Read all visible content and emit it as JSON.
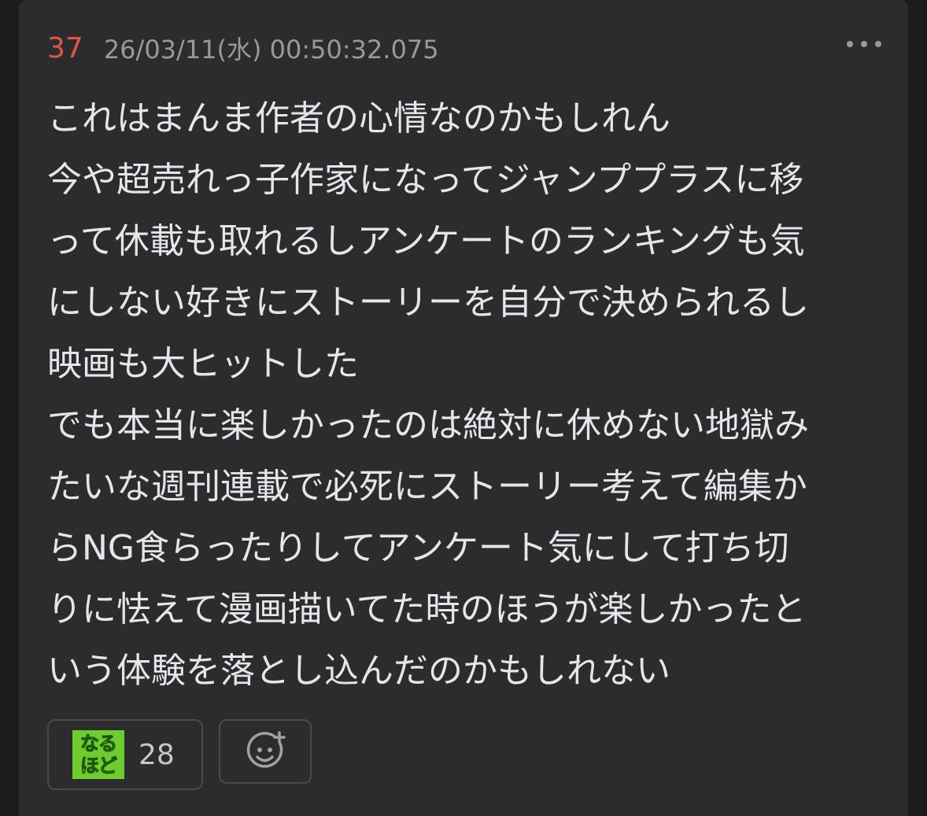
{
  "post": {
    "number": "37",
    "timestamp": "26/03/11(水) 00:50:32.075",
    "body_lines": [
      "これはまんま作者の心情なのかもしれん",
      "今や超売れっ子作家になってジャンププラスに移",
      "って休載も取れるしアンケートのランキングも気",
      "にしない好きにストーリーを自分で決められるし",
      "映画も大ヒットした",
      "でも本当に楽しかったのは絶対に休めない地獄み",
      "たいな週刊連載で必死にストーリー考えて編集か",
      "らNG食らったりしてアンケート気にして打ち切",
      "りに怯えて漫画描いてた時のほうが楽しかったと",
      "いう体験を落とし込んだのかもしれない"
    ]
  },
  "reactions": [
    {
      "stamp_line1": "なる",
      "stamp_line2": "ほど",
      "count": "28"
    }
  ],
  "icons": {
    "more": "more-horizontal-icon",
    "add_reaction": "add-reaction-smiley-icon"
  },
  "colors": {
    "background": "#1c1c1e",
    "card": "#2c2c2e",
    "post_number": "#e0574a",
    "timestamp": "#98989d",
    "body_text": "#e5e5ea",
    "stamp_bg": "#6fcc2e",
    "stamp_text": "#f6e820"
  }
}
